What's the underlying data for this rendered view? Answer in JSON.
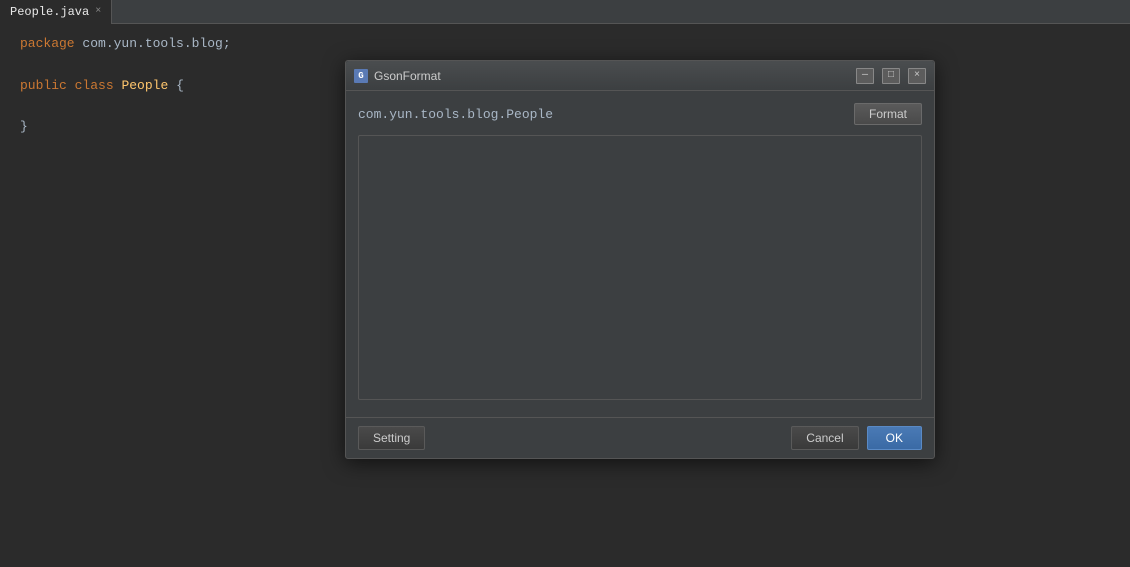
{
  "tab": {
    "filename": "People.java",
    "close_icon": "×"
  },
  "code": {
    "line1_keyword": "package",
    "line1_value": "com.yun.tools.blog;",
    "line2_keyword1": "public",
    "line2_keyword2": "class",
    "line2_class": "People",
    "line2_brace": "{",
    "line3_brace": "}"
  },
  "dialog": {
    "title": "GsonFormat",
    "icon_label": "G",
    "class_name": "com.yun.tools.blog.People",
    "format_label": "Format",
    "json_placeholder": "",
    "setting_label": "Setting",
    "cancel_label": "Cancel",
    "ok_label": "OK",
    "minimize_icon": "—",
    "maximize_icon": "□",
    "close_icon": "×"
  }
}
